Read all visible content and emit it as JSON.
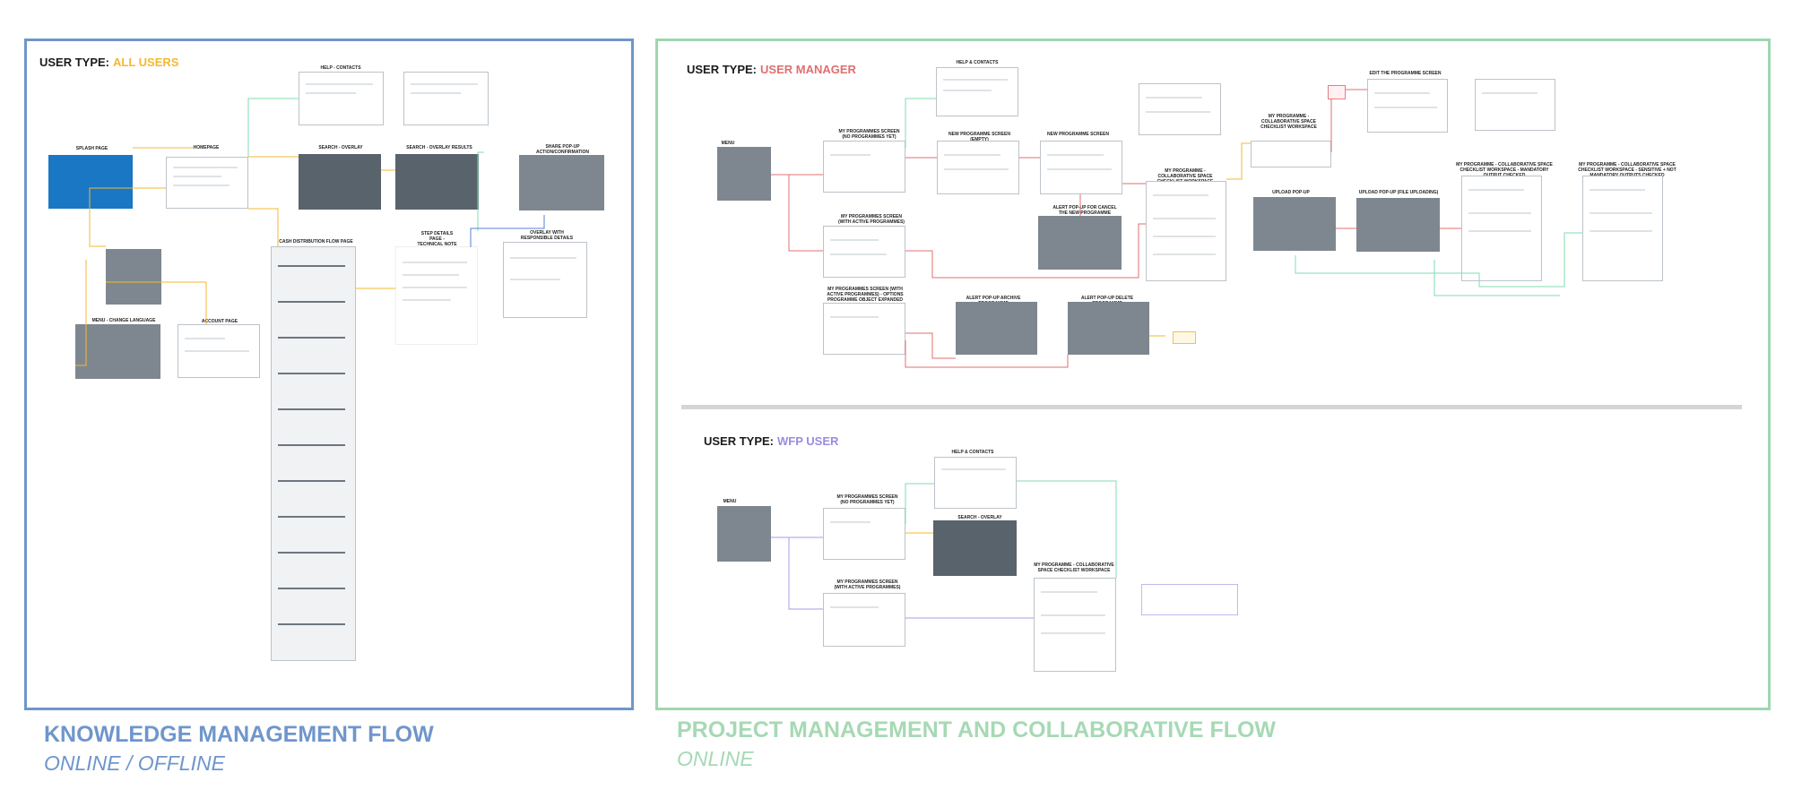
{
  "panels": {
    "knowledge": {
      "user_type_prefix": "USER TYPE:",
      "user_type_role": "ALL USERS",
      "role_color": "#f3b82f",
      "border_color": "#6f96cb",
      "flow_title": "KNOWLEDGE MANAGEMENT FLOW",
      "flow_subtitle": "ONLINE / OFFLINE"
    },
    "project": {
      "user_type_prefix_manager": "USER TYPE:",
      "user_type_role_manager": "USER MANAGER",
      "manager_color": "#e06f6f",
      "user_type_prefix_wfp": "USER TYPE:",
      "user_type_role_wfp": "WFP USER",
      "wfp_color": "#9a8ce0",
      "border_color": "#9fd6b0",
      "flow_title": "PROJECT MANAGEMENT AND COLLABORATIVE FLOW",
      "flow_subtitle": "ONLINE"
    }
  },
  "km_labels": {
    "splash": "SPLASH PAGE",
    "homepage": "HOMEPAGE",
    "help": "HELP - CONTACTS",
    "search_overlay": "SEARCH - OVERLAY",
    "search_results": "SEARCH - OVERLAY RESULTS",
    "share_popup": "SHARE POP-UP ACTION/CONFIRMATION",
    "menu_lang": "MENU - CHANGE LANGUAGE",
    "account": "ACCOUNT PAGE",
    "cash_flow": "CASH DISTRIBUTION FLOW PAGE",
    "step_details": "STEP DETAILS PAGE - TECHNICAL NOTE",
    "overlay_details": "OVERLAY WITH RESPONSIBLE DETAILS"
  },
  "pm_labels": {
    "menu": "MENU",
    "help": "HELP & CONTACTS",
    "my_prog_none": "MY PROGRAMMES SCREEN (NO PROGRAMMES YET)",
    "new_prog_empty": "NEW PROGRAMME SCREEN (EMPTY)",
    "new_prog": "NEW PROGRAMME SCREEN",
    "alert_cancel": "ALERT POP-UP FOR CANCEL THE NEW PROGRAMME CREATION",
    "collab_space": "MY PROGRAMME - COLLABORATIVE SPACE CHECKLIST WORKSPACE",
    "collab_space_2": "MY PROGRAMME - COLLABORATIVE SPACE CHECKLIST WORKSPACE",
    "edit_prog": "EDIT THE PROGRAMME SCREEN",
    "upload": "UPLOAD POP-UP",
    "upload_file": "UPLOAD POP-UP (FILE UPLOADING)",
    "mandatory": "MY PROGRAMME - COLLABORATIVE SPACE CHECKLIST WORKSPACE - MANDATORY OUTPUT CHECKED",
    "mandatory_2": "MY PROGRAMME - COLLABORATIVE SPACE CHECKLIST WORKSPACE - SENSITIVE + NOT MANDATORY OUTPUTS CHECKED",
    "my_prog_active": "MY PROGRAMMES SCREEN (WITH ACTIVE PROGRAMMES)",
    "my_prog_expand": "MY PROGRAMMES SCREEN (WITH ACTIVE PROGRAMMES) - OPTIONS PROGRAMME OBJECT EXPANDED",
    "alert_archive": "ALERT POP-UP ARCHIVE PROGRAMME",
    "alert_delete": "ALERT POP-UP DELETE PROGRAMME"
  },
  "wfp_labels": {
    "menu": "MENU",
    "help": "HELP & CONTACTS",
    "my_prog_none": "MY PROGRAMMES SCREEN (NO PROGRAMMES YET)",
    "search_overlay": "SEARCH - OVERLAY",
    "my_prog_active": "MY PROGRAMMES SCREEN (WITH ACTIVE PROGRAMMES)",
    "collab_space": "MY PROGRAMME - COLLABORATIVE SPACE CHECKLIST WORKSPACE"
  },
  "colors": {
    "arrow_yellow": "#f3b82f",
    "arrow_green": "#7fdcb0",
    "arrow_red": "#e06f6f",
    "arrow_blue": "#5b7fd6",
    "arrow_purple": "#a89be6"
  }
}
